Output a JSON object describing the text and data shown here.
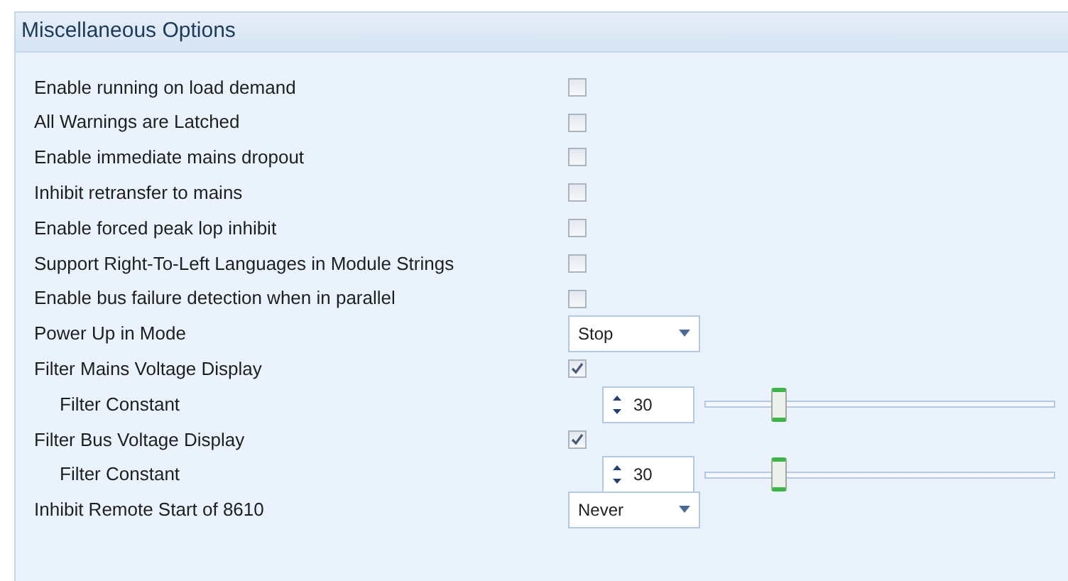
{
  "panel": {
    "title": "Miscellaneous Options"
  },
  "rows": [
    {
      "kind": "checkbox",
      "label": "Enable running on load demand",
      "checked": false
    },
    {
      "kind": "checkbox",
      "label": "All Warnings are Latched",
      "checked": false
    },
    {
      "kind": "checkbox",
      "label": "Enable immediate mains dropout",
      "checked": false
    },
    {
      "kind": "checkbox",
      "label": "Inhibit retransfer to mains",
      "checked": false
    },
    {
      "kind": "checkbox",
      "label": "Enable forced peak lop inhibit",
      "checked": false
    },
    {
      "kind": "checkbox",
      "label": "Support Right-To-Left Languages in Module Strings",
      "checked": false
    },
    {
      "kind": "checkbox",
      "label": "Enable bus failure detection when in parallel",
      "checked": false
    },
    {
      "kind": "dropdown",
      "label": "Power Up in Mode",
      "value": "Stop"
    },
    {
      "kind": "checkbox",
      "label": "Filter Mains Voltage Display",
      "checked": true
    },
    {
      "kind": "slider",
      "label": "Filter Constant",
      "value": "30",
      "level": 0.21
    },
    {
      "kind": "checkbox",
      "label": "Filter Bus Voltage Display",
      "checked": true
    },
    {
      "kind": "slider",
      "label": "Filter Constant",
      "value": "30",
      "level": 0.21
    },
    {
      "kind": "dropdown",
      "label": "Inhibit Remote Start of 8610",
      "value": "Never"
    }
  ]
}
